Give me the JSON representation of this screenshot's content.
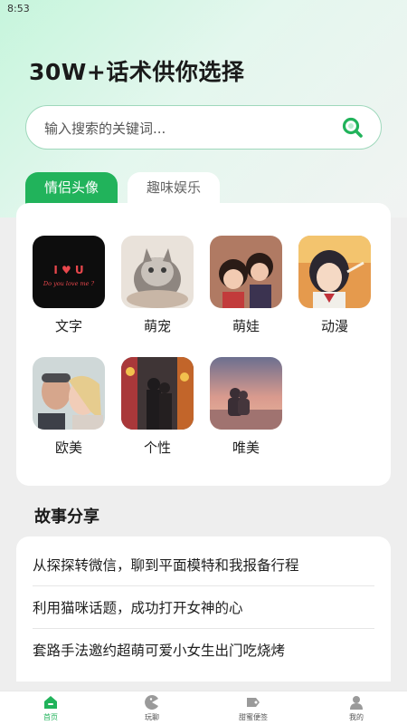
{
  "status_bar": {
    "time": "8:53"
  },
  "header": {
    "headline": "30W+话术供你选择"
  },
  "search": {
    "placeholder": "输入搜索的关键词..."
  },
  "tabs": [
    {
      "label": "情侣头像",
      "active": true
    },
    {
      "label": "趣味娱乐",
      "active": false
    }
  ],
  "avatars": [
    {
      "label": "文字"
    },
    {
      "label": "萌宠"
    },
    {
      "label": "萌娃"
    },
    {
      "label": "动漫"
    },
    {
      "label": "欧美"
    },
    {
      "label": "个性"
    },
    {
      "label": "唯美"
    }
  ],
  "thumb_text": {
    "line1": "I ♥ U",
    "line2": "Do you love me ?"
  },
  "stories": {
    "title": "故事分享",
    "items": [
      "从探探转微信，聊到平面模特和我报备行程",
      "利用猫咪话题，成功打开女神的心",
      "套路手法邀约超萌可爱小女生出门吃烧烤"
    ]
  },
  "bottom_nav": [
    {
      "label": "首页",
      "icon": "home-icon",
      "active": true
    },
    {
      "label": "玩聊",
      "icon": "pacman-icon",
      "active": false
    },
    {
      "label": "甜蜜便签",
      "icon": "tag-icon",
      "active": false
    },
    {
      "label": "我的",
      "icon": "person-icon",
      "active": false
    }
  ],
  "colors": {
    "accent": "#21b35b",
    "search_border": "#9fd8bc",
    "background": "#eeeeee"
  }
}
